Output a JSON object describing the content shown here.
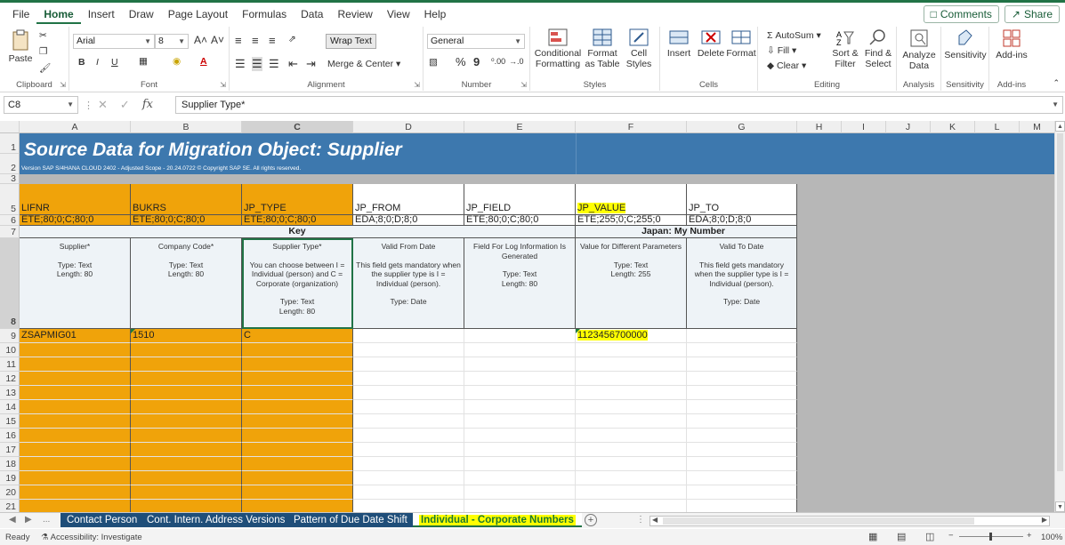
{
  "menubar": {
    "tabs": [
      "File",
      "Home",
      "Insert",
      "Draw",
      "Page Layout",
      "Formulas",
      "Data",
      "Review",
      "View",
      "Help"
    ],
    "active": "Home",
    "comments_label": "Comments",
    "share_label": "Share"
  },
  "ribbon": {
    "clipboard": {
      "label": "Clipboard",
      "paste": "Paste"
    },
    "font": {
      "label": "Font",
      "name": "Arial",
      "size": "8",
      "bold": "B",
      "italic": "I",
      "underline": "U",
      "grow": "A˄",
      "shrink": "A˅"
    },
    "alignment": {
      "label": "Alignment",
      "wrap_text": "Wrap Text",
      "merge_center": "Merge & Center"
    },
    "number": {
      "label": "Number",
      "format": "General",
      "percent": "%",
      "comma": "9",
      "inc_dec": "⁰.00",
      "dec_dec": "→.0"
    },
    "styles": {
      "label": "Styles",
      "conditional": "Conditional Formatting",
      "format_table": "Format as Table",
      "cell_styles": "Cell Styles"
    },
    "cells": {
      "label": "Cells",
      "insert": "Insert",
      "delete": "Delete",
      "format": "Format"
    },
    "editing": {
      "label": "Editing",
      "autosum": "AutoSum",
      "fill": "Fill",
      "clear": "Clear",
      "sort_filter": "Sort & Filter",
      "find_select": "Find & Select"
    },
    "analysis": {
      "label": "Analysis",
      "analyze_data": "Analyze Data"
    },
    "sensitivity": {
      "label": "Sensitivity",
      "button": "Sensitivity"
    },
    "addins": {
      "label": "Add-ins",
      "button": "Add-ins"
    }
  },
  "formula_bar": {
    "name_box": "C8",
    "fx": "fx",
    "content": "Supplier Type*"
  },
  "columns": [
    "A",
    "B",
    "C",
    "D",
    "E",
    "F",
    "G",
    "H",
    "I",
    "J",
    "K",
    "L",
    "M"
  ],
  "rows": [
    "1",
    "2",
    "3",
    "5",
    "6",
    "7",
    "8",
    "9",
    "10",
    "11",
    "12",
    "13",
    "14",
    "15",
    "16",
    "17",
    "18",
    "19",
    "20",
    "21"
  ],
  "sheet": {
    "title": "Source Data for Migration Object:  Supplier",
    "version": "Version SAP S/4HANA CLOUD 2402 - Adjusted Scope - 20.24.0722 © Copyright SAP SE. All rights reserved.",
    "field_names": [
      "LIFNR",
      "BUKRS",
      "JP_TYPE",
      "JP_FROM",
      "JP_FIELD",
      "JP_VALUE",
      "JP_TO"
    ],
    "field_types": [
      "ETE;80;0;C;80;0",
      "ETE;80;0;C;80;0",
      "ETE;80;0;C;80;0",
      "EDA;8;0;D;8;0",
      "ETE;80;0;C;80;0",
      "ETE;255;0;C;255;0",
      "EDA;8;0;D;8;0"
    ],
    "group_key": "Key",
    "group_japan": "Japan: My Number",
    "descriptions": [
      {
        "title": "Supplier*",
        "lines": [
          "Type: Text",
          "Length: 80"
        ]
      },
      {
        "title": "Company Code*",
        "lines": [
          "Type: Text",
          "Length: 80"
        ]
      },
      {
        "title": "Supplier Type*",
        "note": "You can choose between I = Individual (person) and C = Corporate (organization)",
        "lines": [
          "Type: Text",
          "Length: 80"
        ]
      },
      {
        "title": "Valid From Date",
        "note": "This field gets mandatory when the supplier type is I = Individual (person).",
        "lines": [
          "Type: Date"
        ]
      },
      {
        "title": "Field For Log Information Is Generated",
        "lines": [
          "Type: Text",
          "Length: 80"
        ]
      },
      {
        "title": "Value for Different Parameters",
        "lines": [
          "Type: Text",
          "Length: 255"
        ]
      },
      {
        "title": "Valid To Date",
        "note": "This field gets mandatory when the supplier type is I = Individual (person).",
        "lines": [
          "Type: Date"
        ]
      }
    ],
    "data_row": [
      "ZSAPMIG01",
      "1510",
      "C",
      "",
      "",
      "1123456700000",
      ""
    ]
  },
  "sheet_tabs": {
    "tabs": [
      "Contact Person",
      "Cont. Intern. Address Versions",
      "Pattern of Due Date Shift",
      "Individual - Corporate Numbers"
    ],
    "active_index": 3,
    "ellipsis": "..."
  },
  "statusbar": {
    "ready": "Ready",
    "accessibility": "Accessibility: Investigate",
    "zoom": "100%"
  },
  "colors": {
    "title_band": "#3d78ae",
    "orange": "#f0a30a",
    "highlight": "#ffff00",
    "excel_green": "#217346",
    "tab_navy": "#1f4e79"
  }
}
